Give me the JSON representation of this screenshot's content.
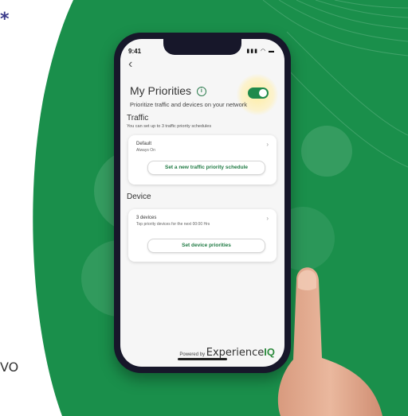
{
  "edge": {
    "top_fragment": "*",
    "bottom_fragment": "VO"
  },
  "colors": {
    "background_green": "#1a8f4b",
    "toggle_on": "#1f8a4c",
    "accent_text": "#1f7a43"
  },
  "status_bar": {
    "time": "9:41",
    "icons": "signal-wifi-battery"
  },
  "header": {
    "back_icon": "chevron-left-icon",
    "title": "My Priorities",
    "info_icon": "info-icon",
    "subtitle": "Prioritize traffic and devices on your network",
    "toggle_on": true
  },
  "traffic": {
    "section_title": "Traffic",
    "note": "You can set up to 3 traffic priority schedules",
    "card": {
      "title": "Default",
      "subtitle": "Always On",
      "button_label": "Set a new traffic priority schedule"
    }
  },
  "device": {
    "section_title": "Device",
    "card": {
      "title": "3 devices",
      "subtitle": "Top priority devices for the next 00:00 Hrs",
      "button_label": "Set device priorities"
    }
  },
  "footer": {
    "powered_by": "Powered by",
    "brand": "Experience",
    "brand_suffix": "IQ"
  }
}
